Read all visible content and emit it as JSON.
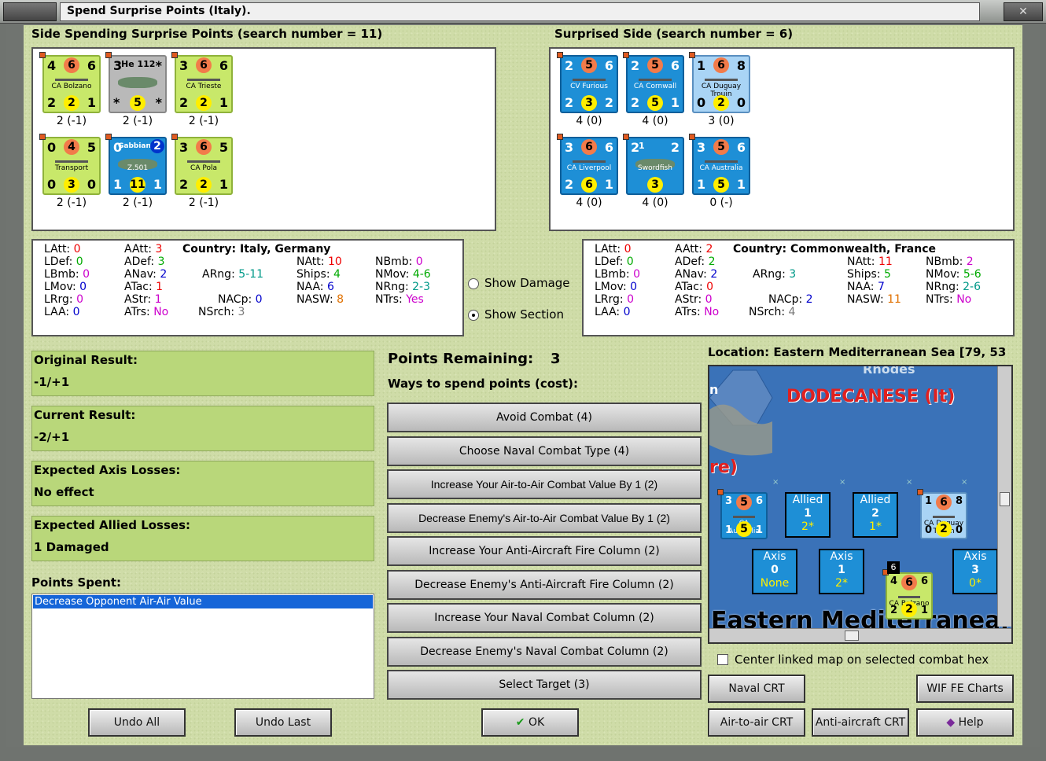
{
  "window": {
    "title": "Spend Surprise Points (Italy)."
  },
  "left_side": {
    "heading": "Side Spending Surprise Points (search number = 11)",
    "units": [
      {
        "tl": "4",
        "tc": "6",
        "tr": "6",
        "name": "CA Bolzano",
        "bl": "2",
        "bc": "2",
        "br": "1",
        "cap": "2 (-1)"
      },
      {
        "tl": "3",
        "tc": "He 112",
        "tr": "*",
        "name": "",
        "bl": "*",
        "bc": "5",
        "br": "*",
        "cap": "2 (-1)"
      },
      {
        "tl": "3",
        "tc": "6",
        "tr": "6",
        "name": "CA Trieste",
        "bl": "2",
        "bc": "2",
        "br": "1",
        "cap": "2 (-1)"
      },
      {
        "tl": "0",
        "tc": "4",
        "tr": "5",
        "name": "Transport",
        "bl": "0",
        "bc": "3",
        "br": "0",
        "cap": "2 (-1)"
      },
      {
        "tl": "0",
        "tc": "Gabbiano",
        "tr": "2",
        "name": "Z.501",
        "bl": "1",
        "bc": "11",
        "br": "1",
        "cap": "2 (-1)"
      },
      {
        "tl": "3",
        "tc": "6",
        "tr": "5",
        "name": "CA Pola",
        "bl": "2",
        "bc": "2",
        "br": "1",
        "cap": "2 (-1)"
      }
    ],
    "country_label": "Country: Italy, Germany",
    "stats": {
      "LAtt": "0",
      "LDef": "0",
      "LBmb": "0",
      "LMov": "0",
      "LRrg": "0",
      "LAA": "0",
      "AAtt": "3",
      "ADef": "3",
      "ANav": "2",
      "ATac": "1",
      "AStr": "1",
      "ATrs": "No",
      "ARng": "5-11",
      "NACp": "0",
      "NSrch": "3",
      "NAtt": "10",
      "Ships": "4",
      "NAA": "6",
      "NASW": "8",
      "NBmb": "0",
      "NMov": "4-6",
      "NRng": "2-3",
      "NTrs": "Yes"
    }
  },
  "right_side": {
    "heading": "Surprised Side (search number = 6)",
    "units": [
      {
        "tl": "2",
        "tc": "5",
        "tr": "6",
        "name": "CV Furious",
        "bl": "2",
        "bc": "3",
        "br": "2",
        "cap": "4 (0)"
      },
      {
        "tl": "2",
        "tc": "5",
        "tr": "6",
        "name": "CA Cornwall",
        "bl": "2",
        "bc": "5",
        "br": "1",
        "cap": "4 (0)"
      },
      {
        "tl": "1",
        "tc": "6",
        "tr": "8",
        "name": "CA Duguay Trouin",
        "bl": "0",
        "bc": "2",
        "br": "0",
        "cap": "3 (0)"
      },
      {
        "tl": "3",
        "tc": "6",
        "tr": "6",
        "name": "CA Liverpool",
        "bl": "2",
        "bc": "6",
        "br": "1",
        "cap": "4 (0)"
      },
      {
        "tl": "2",
        "tc": "1",
        "tr": "2",
        "name": "Swordfish",
        "bl": "",
        "bc": "3",
        "br": "",
        "cap": "4 (0)"
      },
      {
        "tl": "3",
        "tc": "5",
        "tr": "6",
        "name": "CA Australia",
        "bl": "1",
        "bc": "5",
        "br": "1",
        "cap": "0 (-)"
      }
    ],
    "country_label": "Country: Commonwealth, France",
    "stats": {
      "LAtt": "0",
      "LDef": "0",
      "LBmb": "0",
      "LMov": "0",
      "LRrg": "0",
      "LAA": "0",
      "AAtt": "2",
      "ADef": "2",
      "ANav": "2",
      "ATac": "0",
      "AStr": "0",
      "ATrs": "No",
      "ARng": "3",
      "NACp": "2",
      "NSrch": "4",
      "NAtt": "11",
      "Ships": "5",
      "NAA": "7",
      "NASW": "11",
      "NBmb": "2",
      "NMov": "5-6",
      "NRng": "2-6",
      "NTrs": "No"
    }
  },
  "view": {
    "show_damage": "Show Damage",
    "show_section": "Show Section"
  },
  "results": {
    "original_label": "Original Result:",
    "original_value": "-1/+1",
    "current_label": "Current Result:",
    "current_value": "-2/+1",
    "axis_label": "Expected Axis Losses:",
    "axis_value": "No effect",
    "allied_label": "Expected Allied Losses:",
    "allied_value": "1 Damaged"
  },
  "points_spent": {
    "label": "Points Spent:",
    "items": [
      "Decrease Opponent Air-Air Value"
    ]
  },
  "points": {
    "remaining_label": "Points Remaining:",
    "remaining_value": "3",
    "ways_label": "Ways to spend points (cost):"
  },
  "options": [
    "Avoid Combat (4)",
    "Choose Naval Combat Type (4)",
    "Increase Your Air-to-Air Combat Value By 1 (2)",
    "Decrease Enemy's Air-to-Air Combat Value By 1 (2)",
    "Increase Your Anti-Aircraft Fire Column (2)",
    "Decrease Enemy's Anti-Aircraft Fire Column (2)",
    "Increase Your Naval Combat Column (2)",
    "Decrease Enemy's Naval Combat Column (2)",
    "Select Target (3)"
  ],
  "location": {
    "label": "Location: Eastern Mediterranean Sea [79, 53"
  },
  "map": {
    "region": "DODECANESE (It)",
    "rhodes": "Rhodes",
    "sea": "Eastern Mediterranean",
    "frag1": "re)",
    "frag2": "n",
    "allied_boxes": [
      {
        "label": "Allied",
        "num": "1",
        "sub": "2*"
      },
      {
        "label": "Allied",
        "num": "2",
        "sub": "1*"
      }
    ],
    "axis_boxes": [
      {
        "label": "Axis",
        "num": "0",
        "sub": "None"
      },
      {
        "label": "Axis",
        "num": "1",
        "sub": "2*"
      },
      {
        "label": "Axis",
        "num": "3",
        "sub": "0*"
      }
    ],
    "stack_count": "6",
    "map_units": [
      {
        "tl": "3",
        "tc": "5",
        "tr": "6",
        "name": "CA Australia",
        "bl": "1",
        "bc": "5",
        "br": "1"
      },
      {
        "tl": "1",
        "tc": "6",
        "tr": "8",
        "name": "CA Duguay Trouin",
        "bl": "0",
        "bc": "2",
        "br": "0"
      },
      {
        "tl": "4",
        "tc": "6",
        "tr": "6",
        "name": "CA Bolzano",
        "bl": "2",
        "bc": "2",
        "br": "1"
      }
    ]
  },
  "center_map_label": "Center linked map on selected combat hex",
  "buttons": {
    "undo_all": "Undo All",
    "undo_last": "Undo Last",
    "ok": "OK",
    "naval_crt": "Naval CRT",
    "wif_charts": "WIF FE Charts",
    "air_crt": "Air-to-air CRT",
    "aa_crt": "Anti-aircraft CRT",
    "help": "Help"
  },
  "colors": {
    "panel": "#cfdca8",
    "result_box": "#b9d77a",
    "italy_unit": "#c8e86a",
    "allied_unit": "#1e8fd6",
    "selection": "#1565d8"
  }
}
